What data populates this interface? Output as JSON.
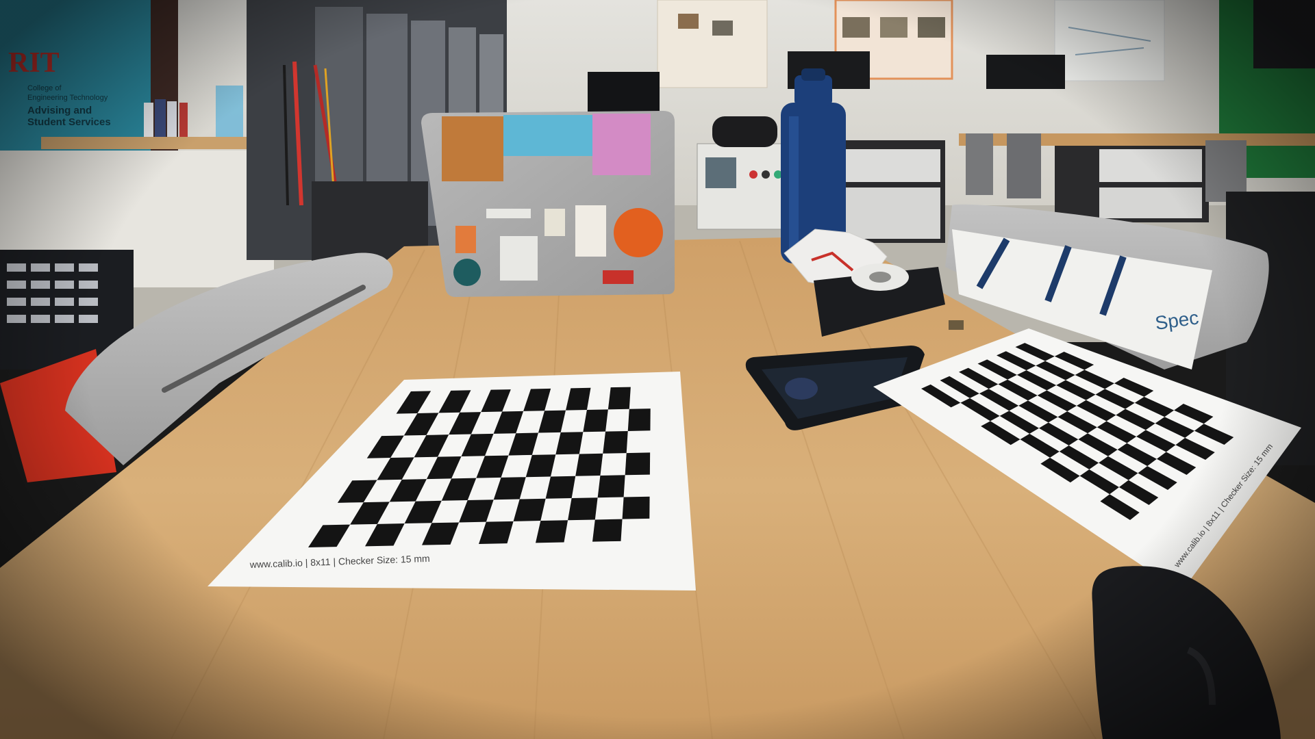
{
  "wall_sign": {
    "logo": "RIT",
    "line1": "College of",
    "line2": "Engineering Technology",
    "line3": "Advising and",
    "line4": "Student Services"
  },
  "board_left": {
    "rows": 7,
    "cols": 12,
    "caption": "www.calib.io | 8x11 | Checker Size: 15 mm"
  },
  "board_right": {
    "caption": "www.calib.io | 8x11 | Checker Size: 15 mm"
  },
  "bag_text": "Spec",
  "colors": {
    "table": "#d9b07a",
    "wall": "#d8d6cf",
    "sign_blue": "#2b8aa0",
    "accent_red": "#c8312a",
    "bottle_blue": "#1c3f7a"
  }
}
